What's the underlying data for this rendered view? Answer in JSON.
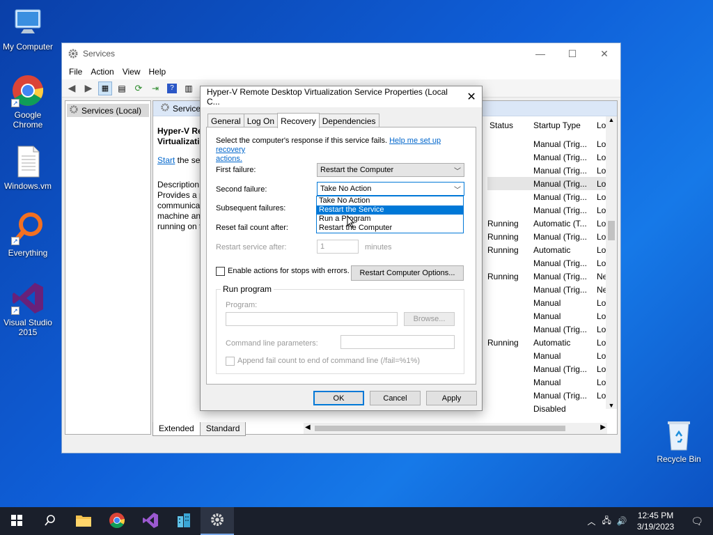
{
  "desktop": {
    "icons": [
      {
        "label": "My Computer"
      },
      {
        "label": "Google Chrome"
      },
      {
        "label": "Windows.vm"
      },
      {
        "label": "Everything"
      },
      {
        "label": "Visual Studio 2015"
      },
      {
        "label": "Recycle Bin"
      }
    ]
  },
  "services_window": {
    "title": "Services",
    "menu": [
      "File",
      "Action",
      "View",
      "Help"
    ],
    "tree_item": "Services (Local)",
    "pane_header": "Service",
    "description": {
      "name_line1": "Hyper-V Re",
      "name_line2": "Virtualizatio",
      "start_link": "Start",
      "start_rest": " the ser",
      "desc_label": "Description:",
      "desc_lines": [
        "Provides a p",
        "communica",
        "machine an",
        "running on t"
      ]
    },
    "columns": {
      "status": "Status",
      "startup": "Startup Type",
      "logon": "Lo"
    },
    "rows": [
      {
        "status": "",
        "startup": "Manual (Trig...",
        "logon": "Lo"
      },
      {
        "status": "",
        "startup": "Manual (Trig...",
        "logon": "Lo"
      },
      {
        "status": "",
        "startup": "Manual (Trig...",
        "logon": "Lo"
      },
      {
        "status": "",
        "startup": "Manual (Trig...",
        "logon": "Lo"
      },
      {
        "status": "",
        "startup": "Manual (Trig...",
        "logon": "Lo"
      },
      {
        "status": "",
        "startup": "Manual (Trig...",
        "logon": "Lo"
      },
      {
        "status": "Running",
        "startup": "Automatic (T...",
        "logon": "Lo"
      },
      {
        "status": "Running",
        "startup": "Manual (Trig...",
        "logon": "Lo"
      },
      {
        "status": "Running",
        "startup": "Automatic",
        "logon": "Lo"
      },
      {
        "status": "",
        "startup": "Manual (Trig...",
        "logon": "Lo"
      },
      {
        "status": "Running",
        "startup": "Manual (Trig...",
        "logon": "Ne"
      },
      {
        "status": "",
        "startup": "Manual (Trig...",
        "logon": "Ne"
      },
      {
        "status": "",
        "startup": "Manual",
        "logon": "Lo"
      },
      {
        "status": "",
        "startup": "Manual",
        "logon": "Lo"
      },
      {
        "status": "",
        "startup": "Manual (Trig...",
        "logon": "Lo"
      },
      {
        "status": "Running",
        "startup": "Automatic",
        "logon": "Lo"
      },
      {
        "status": "",
        "startup": "Manual",
        "logon": "Lo"
      },
      {
        "status": "",
        "startup": "Manual (Trig...",
        "logon": "Lo"
      },
      {
        "status": "",
        "startup": "Manual",
        "logon": "Lo"
      },
      {
        "status": "",
        "startup": "Manual (Trig...",
        "logon": "Lo"
      },
      {
        "status": "",
        "startup": "Disabled",
        "logon": ""
      }
    ],
    "bottom_tabs": [
      "Extended",
      "Standard"
    ]
  },
  "dialog": {
    "title": "Hyper-V Remote Desktop Virtualization Service Properties (Local C...",
    "tabs": [
      "General",
      "Log On",
      "Recovery",
      "Dependencies"
    ],
    "active_tab": "Recovery",
    "intro": "Select the computer's response if this service fails.",
    "help_link_1": "Help me set up recovery",
    "help_link_2": "actions.",
    "first_failure_label": "First failure:",
    "first_failure_value": "Restart the Computer",
    "second_failure_label": "Second failure:",
    "second_failure_value": "Take No Action",
    "subsequent_label": "Subsequent failures:",
    "reset_label": "Reset fail count after:",
    "restart_after_label": "Restart service after:",
    "restart_after_value": "1",
    "minutes_label": "minutes",
    "dropdown_options": [
      "Take No Action",
      "Restart the Service",
      "Run a Program",
      "Restart the Computer"
    ],
    "enable_actions_label": "Enable actions for stops with errors.",
    "restart_options_button": "Restart Computer Options...",
    "run_program_group": "Run program",
    "program_label": "Program:",
    "browse_button": "Browse...",
    "cmd_params_label": "Command line parameters:",
    "append_label": "Append fail count to end of command line (/fail=%1%)",
    "ok_button": "OK",
    "cancel_button": "Cancel",
    "apply_button": "Apply"
  },
  "taskbar": {
    "time": "12:45 PM",
    "date": "3/19/2023"
  }
}
